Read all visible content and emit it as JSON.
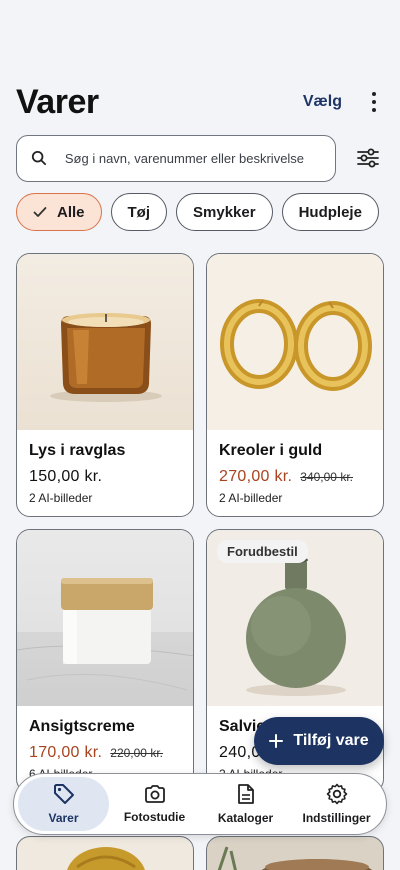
{
  "header": {
    "title": "Varer",
    "select_label": "Vælg"
  },
  "search": {
    "placeholder": "Søg i navn, varenummer eller beskrivelse"
  },
  "chips": [
    {
      "label": "Alle",
      "active": true
    },
    {
      "label": "Tøj",
      "active": false
    },
    {
      "label": "Smykker",
      "active": false
    },
    {
      "label": "Hudpleje",
      "active": false
    }
  ],
  "products": [
    {
      "name": "Lys i ravglas",
      "price": "150,00 kr.",
      "old_price": "",
      "ai_images": "2 AI-billeder",
      "badge": ""
    },
    {
      "name": "Kreoler i guld",
      "price": "270,00 kr.",
      "old_price": "340,00 kr.",
      "ai_images": "2 AI-billeder",
      "badge": ""
    },
    {
      "name": "Ansigtscreme",
      "price": "170,00 kr.",
      "old_price": "220,00 kr.",
      "ai_images": "6 AI-billeder",
      "badge": ""
    },
    {
      "name": "Salvie",
      "price": "240,00 kr.",
      "old_price": "",
      "ai_images": "2 AI-billeder",
      "badge": "Forudbestil"
    }
  ],
  "fab": {
    "label": "Tilføj vare"
  },
  "nav": [
    {
      "label": "Varer",
      "icon": "tag-icon",
      "active": true
    },
    {
      "label": "Fotostudie",
      "icon": "camera-icon",
      "active": false
    },
    {
      "label": "Kataloger",
      "icon": "document-icon",
      "active": false
    },
    {
      "label": "Indstillinger",
      "icon": "gear-icon",
      "active": false
    }
  ],
  "colors": {
    "accent": "#1d3463",
    "sale": "#a8431e",
    "chip_active_bg": "#fbe3d6",
    "chip_active_border": "#d9734a"
  }
}
